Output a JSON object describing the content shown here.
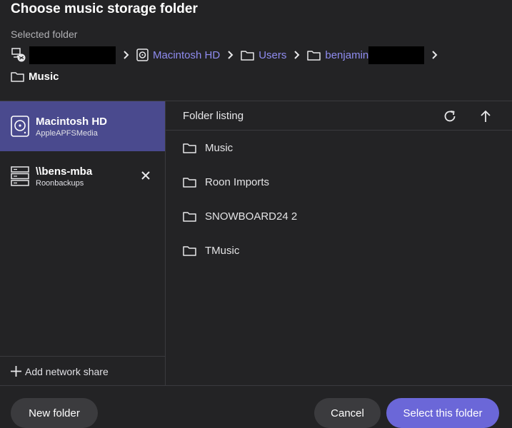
{
  "dialog": {
    "title": "Choose music storage folder"
  },
  "selected": {
    "label": "Selected folder",
    "path": [
      {
        "name": "Macintosh HD"
      },
      {
        "name": "Users"
      },
      {
        "name": "benjamin"
      }
    ],
    "current": "Music"
  },
  "sidebar": {
    "devices": [
      {
        "name": "Macintosh HD",
        "subtitle": "AppleAPFSMedia",
        "icon": "hard-drive-icon"
      },
      {
        "name": "\\\\bens-mba",
        "subtitle": "Roonbackups",
        "icon": "server-icon"
      }
    ],
    "add_share_label": "Add network share"
  },
  "listing": {
    "title": "Folder listing",
    "folders": [
      "Music",
      "Roon Imports",
      "SNOWBOARD24 2",
      "TMusic"
    ]
  },
  "footer": {
    "new_folder_label": "New folder",
    "cancel_label": "Cancel",
    "select_label": "Select this folder"
  },
  "colors": {
    "accent": "#6b67d8",
    "link": "#8f8cf0",
    "active_device": "#4a4a8e",
    "background": "#232325"
  }
}
